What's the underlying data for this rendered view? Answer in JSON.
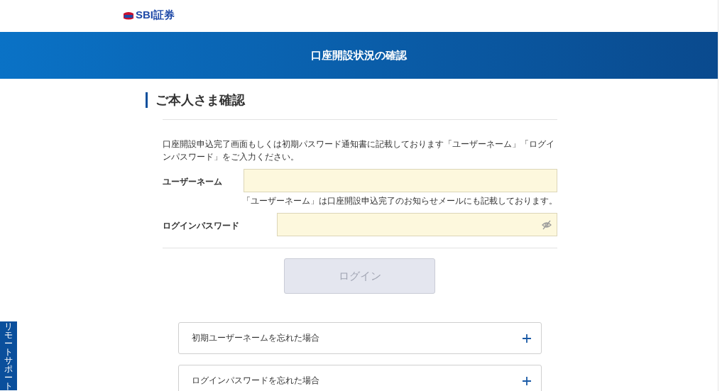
{
  "header": {
    "logo_text": "SBI証券"
  },
  "banner": {
    "title": "口座開設状況の確認"
  },
  "section": {
    "title": "ご本人さま確認",
    "intro": "口座開設申込完了画面もしくは初期パスワード通知書に記載しております「ユーザーネーム」「ログインパスワード」をご入力ください。"
  },
  "fields": [
    {
      "label": "ユーザーネーム",
      "kind": "text",
      "hint": "「ユーザーネーム」は口座開設申込完了のお知らせメールにも記載しております。"
    },
    {
      "label": "ログインパスワード",
      "kind": "password",
      "revealed": false
    }
  ],
  "login_button": {
    "label": "ログイン",
    "disabled": true
  },
  "accordions": [
    {
      "label": "初期ユーザーネームを忘れた場合",
      "expanded": false
    },
    {
      "label": "ログインパスワードを忘れた場合",
      "expanded": false
    }
  ],
  "side_tab": {
    "label": "リモートサポート"
  }
}
